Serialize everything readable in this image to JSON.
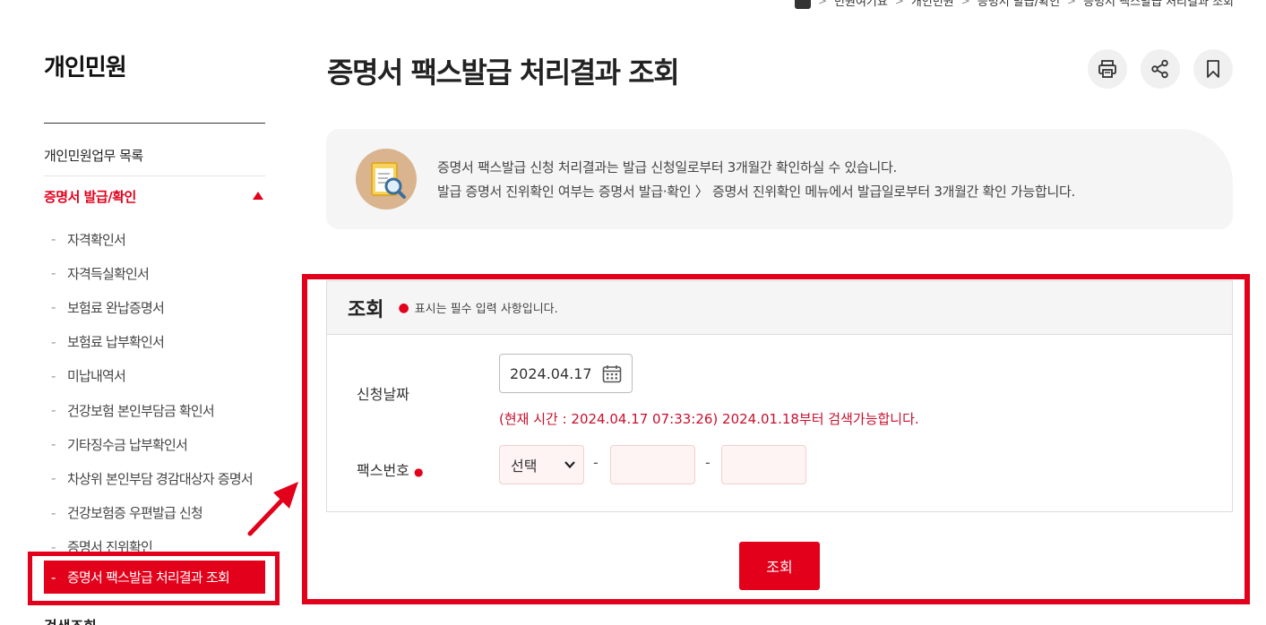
{
  "breadcrumb": [
    "민원여기요",
    "개인민원",
    "증명서 발급/확인",
    "증명서 팩스발급 처리결과 조회"
  ],
  "sidebar": {
    "title": "개인민원",
    "top_item": "개인민원업무 목록",
    "active_section": "증명서 발급/확인",
    "sub_items": [
      "자격확인서",
      "자격득실확인서",
      "보험료 완납증명서",
      "보험료 납부확인서",
      "미납내역서",
      "건강보험 본인부담금 확인서",
      "기타징수금 납부확인서",
      "차상위 본인부담 경감대상자 증명서",
      "건강보험증 우편발급 신청",
      "증명서 진위확인"
    ],
    "selected_item": "증명서 팩스발급 처리결과 조회",
    "next_section": "검색조회"
  },
  "page": {
    "title": "증명서 팩스발급 처리결과 조회"
  },
  "toolbar": {
    "print_icon": "print-icon",
    "share_icon": "share-icon",
    "bookmark_icon": "bookmark-icon"
  },
  "info": {
    "line1": "증명서 팩스발급 신청 처리결과는 발급 신청일로부터 3개월간 확인하실 수 있습니다.",
    "line2": "발급 증명서 진위확인 여부는 증명서 발급·확인 〉 증명서 진위확인 메뉴에서 발급일로부터 3개월간 확인 가능합니다."
  },
  "search": {
    "heading": "조회",
    "required_note": "표시는 필수 입력 사항입니다.",
    "date_label": "신청날짜",
    "date_value": "2024.04.17",
    "date_notice": "(현재 시간 : 2024.04.17 07:33:26) 2024.01.18부터 검색가능합니다.",
    "fax_label": "팩스번호",
    "fax_select": "선택",
    "fax_sep": "-",
    "button": "조회"
  },
  "colors": {
    "accent": "#e2001a",
    "notice": "#c8102e"
  }
}
